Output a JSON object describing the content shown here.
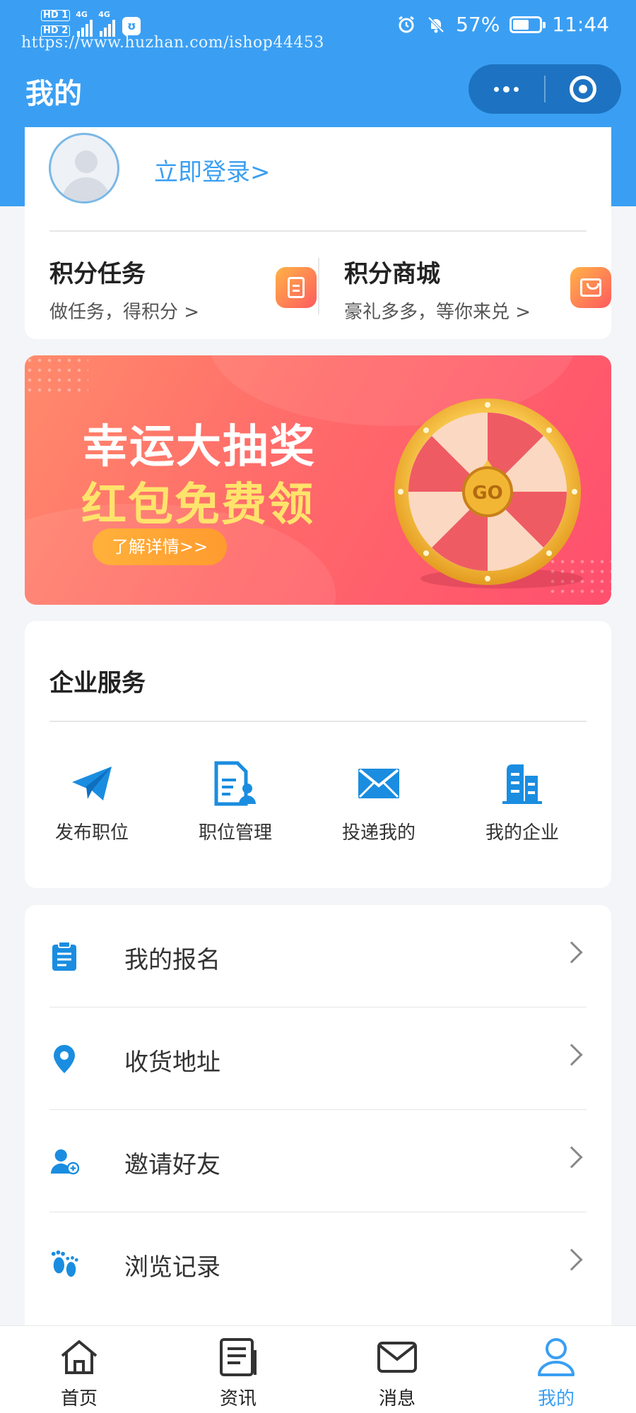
{
  "status_bar": {
    "hd1": "HD 1",
    "hd2": "HD 2",
    "net1": "4G",
    "net2": "4G",
    "battery": "57%",
    "time": "11:44"
  },
  "watermark": "https://www.huzhan.com/ishop44453",
  "header": {
    "title": "我的"
  },
  "user_card": {
    "login_label": "立即登录>",
    "points_task": {
      "title": "积分任务",
      "subtitle": "做任务，得积分 >"
    },
    "points_mall": {
      "title": "积分商城",
      "subtitle": "豪礼多多，等你来兑 >"
    }
  },
  "banner": {
    "line1": "幸运大抽奖",
    "line2": "红包免费领",
    "button_label": "了解详情>>",
    "wheel_label": "GO"
  },
  "enterprise": {
    "title": "企业服务",
    "items": [
      {
        "label": "发布职位",
        "icon": "paper-plane-icon"
      },
      {
        "label": "职位管理",
        "icon": "document-person-icon"
      },
      {
        "label": "投递我的",
        "icon": "envelope-icon"
      },
      {
        "label": "我的企业",
        "icon": "building-icon"
      }
    ]
  },
  "menu": [
    {
      "label": "我的报名",
      "icon": "clipboard-icon"
    },
    {
      "label": "收货地址",
      "icon": "location-pin-icon"
    },
    {
      "label": "邀请好友",
      "icon": "add-user-icon"
    },
    {
      "label": "浏览记录",
      "icon": "footprint-icon"
    }
  ],
  "tabbar": {
    "items": [
      {
        "label": "首页",
        "icon": "home-icon"
      },
      {
        "label": "资讯",
        "icon": "news-icon"
      },
      {
        "label": "消息",
        "icon": "mail-icon"
      },
      {
        "label": "我的",
        "icon": "user-icon"
      }
    ],
    "active_index": 3
  },
  "colors": {
    "primary": "#3a9ff3",
    "capsule": "#1d73c2",
    "banner_start": "#ff8a6b",
    "banner_end": "#ff4f6e",
    "banner_accent": "#ffe36b",
    "badge_start": "#ffb347",
    "badge_end": "#ff5a5f"
  }
}
